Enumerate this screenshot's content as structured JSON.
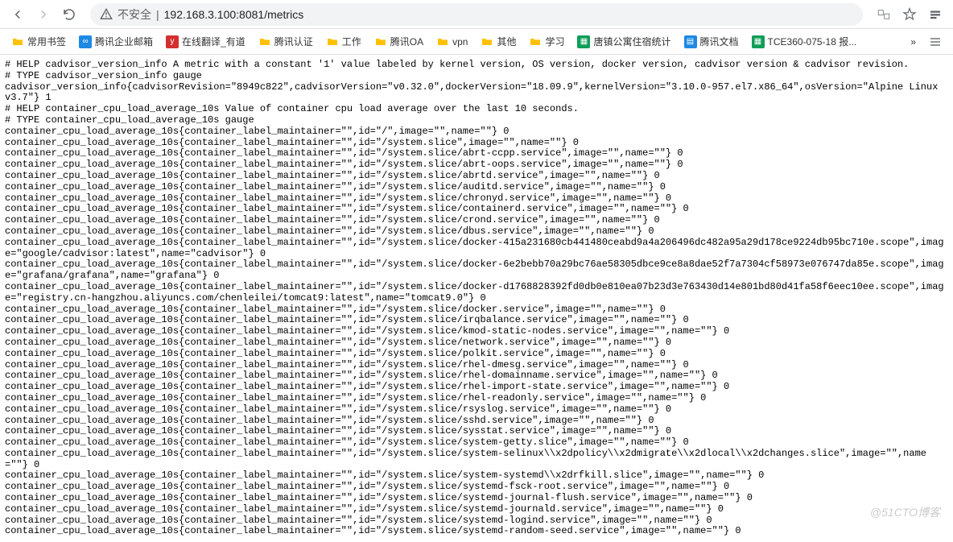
{
  "toolbar": {
    "insecure_label": "不安全",
    "url": "192.168.3.100:8081/metrics"
  },
  "bookmarks": [
    {
      "label": "常用书签",
      "color": "#ffc107"
    },
    {
      "label": "腾讯企业邮箱",
      "color": "#1e88e5",
      "letter": "∞"
    },
    {
      "label": "在线翻译_有道",
      "color": "#d32f2f",
      "letter": "y"
    },
    {
      "label": "腾讯认证",
      "color": "#ffc107"
    },
    {
      "label": "工作",
      "color": "#ffc107"
    },
    {
      "label": "腾讯OA",
      "color": "#ffc107"
    },
    {
      "label": "vpn",
      "color": "#ffc107"
    },
    {
      "label": "其他",
      "color": "#ffc107"
    },
    {
      "label": "学习",
      "color": "#ffc107"
    },
    {
      "label": "唐镇公寓住宿统计",
      "color": "#0f9d58",
      "letter": "▦"
    },
    {
      "label": "腾讯文档",
      "color": "#1e88e5",
      "letter": "▤"
    },
    {
      "label": "TCE360-075-18 报...",
      "color": "#0f9d58",
      "letter": "▦"
    }
  ],
  "metrics_lines": [
    "# HELP cadvisor_version_info A metric with a constant '1' value labeled by kernel version, OS version, docker version, cadvisor version & cadvisor revision.",
    "# TYPE cadvisor_version_info gauge",
    "cadvisor_version_info{cadvisorRevision=\"8949c822\",cadvisorVersion=\"v0.32.0\",dockerVersion=\"18.09.9\",kernelVersion=\"3.10.0-957.el7.x86_64\",osVersion=\"Alpine Linux v3.7\"} 1",
    "# HELP container_cpu_load_average_10s Value of container cpu load average over the last 10 seconds.",
    "# TYPE container_cpu_load_average_10s gauge",
    "container_cpu_load_average_10s{container_label_maintainer=\"\",id=\"/\",image=\"\",name=\"\"} 0",
    "container_cpu_load_average_10s{container_label_maintainer=\"\",id=\"/system.slice\",image=\"\",name=\"\"} 0",
    "container_cpu_load_average_10s{container_label_maintainer=\"\",id=\"/system.slice/abrt-ccpp.service\",image=\"\",name=\"\"} 0",
    "container_cpu_load_average_10s{container_label_maintainer=\"\",id=\"/system.slice/abrt-oops.service\",image=\"\",name=\"\"} 0",
    "container_cpu_load_average_10s{container_label_maintainer=\"\",id=\"/system.slice/abrtd.service\",image=\"\",name=\"\"} 0",
    "container_cpu_load_average_10s{container_label_maintainer=\"\",id=\"/system.slice/auditd.service\",image=\"\",name=\"\"} 0",
    "container_cpu_load_average_10s{container_label_maintainer=\"\",id=\"/system.slice/chronyd.service\",image=\"\",name=\"\"} 0",
    "container_cpu_load_average_10s{container_label_maintainer=\"\",id=\"/system.slice/containerd.service\",image=\"\",name=\"\"} 0",
    "container_cpu_load_average_10s{container_label_maintainer=\"\",id=\"/system.slice/crond.service\",image=\"\",name=\"\"} 0",
    "container_cpu_load_average_10s{container_label_maintainer=\"\",id=\"/system.slice/dbus.service\",image=\"\",name=\"\"} 0",
    "container_cpu_load_average_10s{container_label_maintainer=\"\",id=\"/system.slice/docker-415a231680cb441480ceabd9a4a206496dc482a95a29d178ce9224db95bc710e.scope\",image=\"google/cadvisor:latest\",name=\"cadvisor\"} 0",
    "container_cpu_load_average_10s{container_label_maintainer=\"\",id=\"/system.slice/docker-6e2bebb70a29bc76ae58305dbce9ce8a8dae52f7a7304cf58973e076747da85e.scope\",image=\"grafana/grafana\",name=\"grafana\"} 0",
    "container_cpu_load_average_10s{container_label_maintainer=\"\",id=\"/system.slice/docker-d1768828392fd0db0e810ea07b23d3e763430d14e801bd80d41fa58f6eec10ee.scope\",image=\"registry.cn-hangzhou.aliyuncs.com/chenleilei/tomcat9:latest\",name=\"tomcat9.0\"} 0",
    "container_cpu_load_average_10s{container_label_maintainer=\"\",id=\"/system.slice/docker.service\",image=\"\",name=\"\"} 0",
    "container_cpu_load_average_10s{container_label_maintainer=\"\",id=\"/system.slice/irqbalance.service\",image=\"\",name=\"\"} 0",
    "container_cpu_load_average_10s{container_label_maintainer=\"\",id=\"/system.slice/kmod-static-nodes.service\",image=\"\",name=\"\"} 0",
    "container_cpu_load_average_10s{container_label_maintainer=\"\",id=\"/system.slice/network.service\",image=\"\",name=\"\"} 0",
    "container_cpu_load_average_10s{container_label_maintainer=\"\",id=\"/system.slice/polkit.service\",image=\"\",name=\"\"} 0",
    "container_cpu_load_average_10s{container_label_maintainer=\"\",id=\"/system.slice/rhel-dmesg.service\",image=\"\",name=\"\"} 0",
    "container_cpu_load_average_10s{container_label_maintainer=\"\",id=\"/system.slice/rhel-domainname.service\",image=\"\",name=\"\"} 0",
    "container_cpu_load_average_10s{container_label_maintainer=\"\",id=\"/system.slice/rhel-import-state.service\",image=\"\",name=\"\"} 0",
    "container_cpu_load_average_10s{container_label_maintainer=\"\",id=\"/system.slice/rhel-readonly.service\",image=\"\",name=\"\"} 0",
    "container_cpu_load_average_10s{container_label_maintainer=\"\",id=\"/system.slice/rsyslog.service\",image=\"\",name=\"\"} 0",
    "container_cpu_load_average_10s{container_label_maintainer=\"\",id=\"/system.slice/sshd.service\",image=\"\",name=\"\"} 0",
    "container_cpu_load_average_10s{container_label_maintainer=\"\",id=\"/system.slice/sysstat.service\",image=\"\",name=\"\"} 0",
    "container_cpu_load_average_10s{container_label_maintainer=\"\",id=\"/system.slice/system-getty.slice\",image=\"\",name=\"\"} 0",
    "container_cpu_load_average_10s{container_label_maintainer=\"\",id=\"/system.slice/system-selinux\\\\x2dpolicy\\\\x2dmigrate\\\\x2dlocal\\\\x2dchanges.slice\",image=\"\",name=\"\"} 0",
    "container_cpu_load_average_10s{container_label_maintainer=\"\",id=\"/system.slice/system-systemd\\\\x2drfkill.slice\",image=\"\",name=\"\"} 0",
    "container_cpu_load_average_10s{container_label_maintainer=\"\",id=\"/system.slice/systemd-fsck-root.service\",image=\"\",name=\"\"} 0",
    "container_cpu_load_average_10s{container_label_maintainer=\"\",id=\"/system.slice/systemd-journal-flush.service\",image=\"\",name=\"\"} 0",
    "container_cpu_load_average_10s{container_label_maintainer=\"\",id=\"/system.slice/systemd-journald.service\",image=\"\",name=\"\"} 0",
    "container_cpu_load_average_10s{container_label_maintainer=\"\",id=\"/system.slice/systemd-logind.service\",image=\"\",name=\"\"} 0",
    "container_cpu_load_average_10s{container_label_maintainer=\"\",id=\"/system.slice/systemd-random-seed.service\",image=\"\",name=\"\"} 0"
  ],
  "watermark": "@51CTO博客"
}
